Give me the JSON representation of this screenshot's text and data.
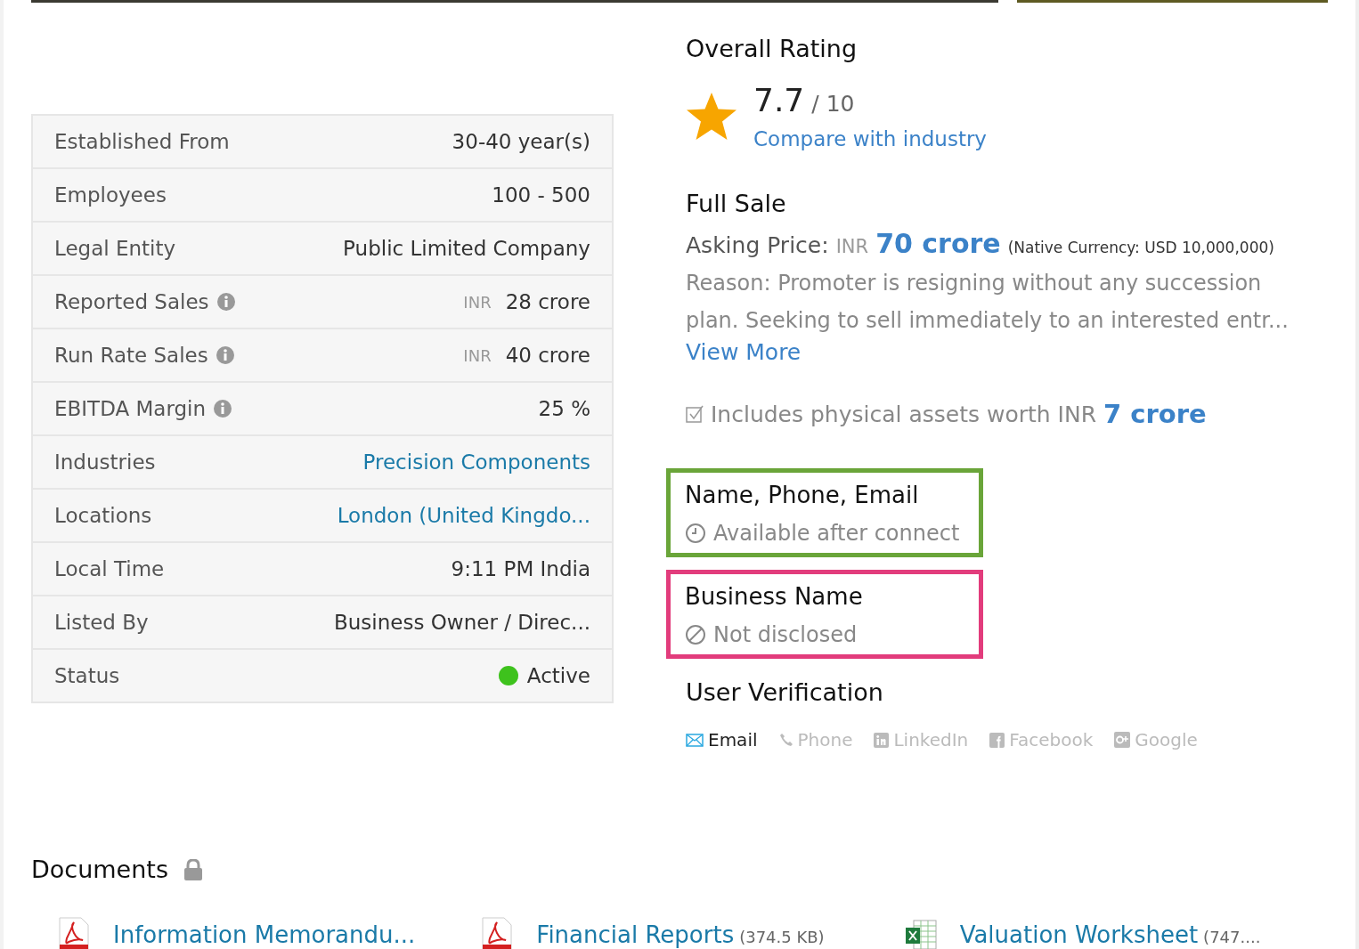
{
  "photos": [
    {
      "kind": "wide"
    },
    {
      "kind": "narrow"
    }
  ],
  "details": [
    {
      "label": "Established From",
      "info": false,
      "kind": "text",
      "value": "30-40 year(s)"
    },
    {
      "label": "Employees",
      "info": false,
      "kind": "text",
      "value": "100 - 500"
    },
    {
      "label": "Legal Entity",
      "info": false,
      "kind": "text",
      "value": "Public Limited Company"
    },
    {
      "label": "Reported Sales",
      "info": true,
      "kind": "money",
      "currency": "INR",
      "value": "28 crore"
    },
    {
      "label": "Run Rate Sales",
      "info": true,
      "kind": "money",
      "currency": "INR",
      "value": "40 crore"
    },
    {
      "label": "EBITDA Margin",
      "info": true,
      "kind": "text",
      "value": "25 %"
    },
    {
      "label": "Industries",
      "info": false,
      "kind": "link",
      "value": "Precision Components"
    },
    {
      "label": "Locations",
      "info": false,
      "kind": "link",
      "value": "London (United Kingdo..."
    },
    {
      "label": "Local Time",
      "info": false,
      "kind": "text",
      "value": "9:11 PM India"
    },
    {
      "label": "Listed By",
      "info": false,
      "kind": "text",
      "value": "Business Owner / Direc..."
    },
    {
      "label": "Status",
      "info": false,
      "kind": "status",
      "value": "Active",
      "color": "#3ec21d"
    }
  ],
  "rating": {
    "title": "Overall Rating",
    "score": "7.7",
    "scale": "/ 10",
    "link": "Compare with industry"
  },
  "sale": {
    "title": "Full Sale",
    "price_label": "Asking Price:",
    "currency": "INR",
    "price": "70 crore",
    "native": "(Native Currency: USD 10,000,000)",
    "reason": "Reason: Promoter is resigning without any succession plan. Seeking to sell immediately to an interested entr...",
    "view_more": "View More",
    "assets_text": "Includes physical assets worth INR",
    "assets_value": "7 crore"
  },
  "contact_boxes": [
    {
      "title": "Name, Phone, Email",
      "note": "Available after connect",
      "kind": "clock",
      "color": "#6aa539"
    },
    {
      "title": "Business Name",
      "note": "Not disclosed",
      "kind": "blocked",
      "color": "#e23c7c"
    }
  ],
  "verification": {
    "title": "User Verification",
    "items": [
      {
        "kind": "email",
        "label": "Email",
        "verified": true
      },
      {
        "kind": "phone",
        "label": "Phone",
        "verified": false
      },
      {
        "kind": "linkedin",
        "label": "LinkedIn",
        "verified": false
      },
      {
        "kind": "facebook",
        "label": "Facebook",
        "verified": false
      },
      {
        "kind": "google",
        "label": "Google",
        "verified": false
      }
    ]
  },
  "documents": {
    "title": "Documents",
    "items": [
      {
        "kind": "pdf",
        "name": "Information Memorandu..."
      },
      {
        "kind": "pdf",
        "name": "Financial Reports",
        "size": "(374.5 KB)"
      },
      {
        "kind": "xls",
        "name": "Valuation Worksheet",
        "size": "(747...."
      }
    ]
  }
}
